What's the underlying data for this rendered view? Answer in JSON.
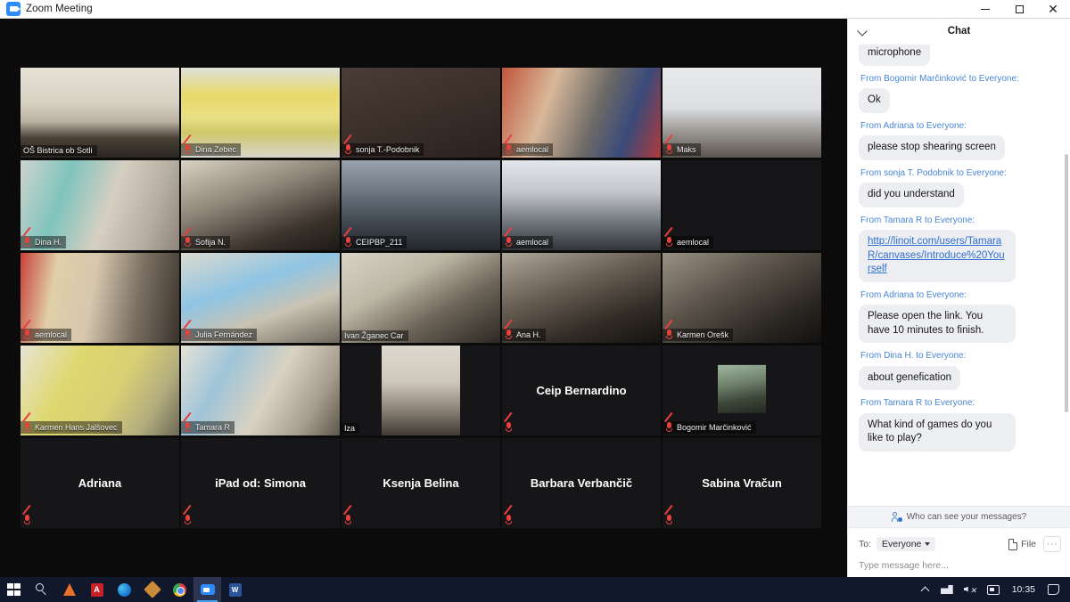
{
  "window": {
    "title": "Zoom Meeting",
    "app_icon": "zoom-camera-icon",
    "minimize_label": "",
    "maximize_label": "",
    "close_label": "✕"
  },
  "chat": {
    "title": "Chat",
    "collapse_icon": "chevron-down-icon",
    "messages": [
      {
        "from": "",
        "text": "microphone",
        "partial": true,
        "link": false
      },
      {
        "from": "From Bogomir Marčinković to Everyone:",
        "text": "Ok",
        "link": false
      },
      {
        "from": "From Adriana to Everyone:",
        "text": "please stop shearing screen",
        "link": false
      },
      {
        "from": "From sonja T. Podobnik to Everyone:",
        "text": "did you understand",
        "link": false
      },
      {
        "from": "From Tamara R to Everyone:",
        "text": "http://linoit.com/users/TamaraR/canvases/Introduce%20Yourself",
        "link": true
      },
      {
        "from": "From Adriana to Everyone:",
        "text": "Please open the link. You have 10 minutes to finish.",
        "link": false
      },
      {
        "from": "From Dina H. to Everyone:",
        "text": "about genefication",
        "link": false
      },
      {
        "from": "From Tamara R to Everyone:",
        "text": "What kind of games do you like to play?",
        "link": false
      }
    ],
    "notice": "Who can see your messages?",
    "notice_icon": "people-icon",
    "to_label": "To:",
    "to_value": "Everyone",
    "file_label": "File",
    "file_icon": "file-icon",
    "more_label": "···",
    "input_placeholder": "Type message here..."
  },
  "gallery": {
    "participants": [
      {
        "name": "OŠ Bistrica ob Sotli",
        "muted": false,
        "kind": "video",
        "bg": "classroom-a",
        "speaking": false
      },
      {
        "name": "Dina Zebec",
        "muted": true,
        "kind": "video",
        "bg": "masked-woman-yellow",
        "speaking": false
      },
      {
        "name": "sonja T.-Podobnik",
        "muted": true,
        "kind": "video",
        "bg": "dark-brown",
        "speaking": false
      },
      {
        "name": "aemlocal",
        "muted": true,
        "kind": "video",
        "bg": "classroom-red-flag",
        "speaking": false
      },
      {
        "name": "Maks",
        "muted": true,
        "kind": "video",
        "bg": "window-bright",
        "speaking": false
      },
      {
        "name": "Dina H.",
        "muted": true,
        "kind": "video",
        "bg": "girls-teal",
        "speaking": false
      },
      {
        "name": "Sofija N.",
        "muted": true,
        "kind": "video",
        "bg": "masked-girl-dark",
        "speaking": false
      },
      {
        "name": "CEIPBP_211",
        "muted": true,
        "kind": "video",
        "bg": "classroom-ceiling",
        "speaking": false
      },
      {
        "name": "aemlocal",
        "muted": true,
        "kind": "video",
        "bg": "ceiling-light",
        "speaking": false
      },
      {
        "name": "aemlocal",
        "muted": true,
        "kind": "blank",
        "bg": "black",
        "speaking": false
      },
      {
        "name": "aemlocal",
        "muted": true,
        "kind": "video",
        "bg": "flag-room",
        "speaking": false
      },
      {
        "name": "Julia Fernández",
        "muted": true,
        "kind": "video",
        "bg": "mask-light-blue",
        "speaking": false
      },
      {
        "name": "Ivan Žganec Car",
        "muted": false,
        "kind": "video",
        "bg": "classroom-boy",
        "speaking": false
      },
      {
        "name": "Ana H.",
        "muted": true,
        "kind": "video",
        "bg": "dark-mask-girl",
        "speaking": false
      },
      {
        "name": "Karmen Orešk",
        "muted": true,
        "kind": "video",
        "bg": "mask-dark-room",
        "speaking": false
      },
      {
        "name": "Karmen Hans Jalšovec",
        "muted": true,
        "kind": "video",
        "bg": "yellow-wall-woman",
        "speaking": false
      },
      {
        "name": "Tamara R",
        "muted": true,
        "kind": "video",
        "bg": "poster-wall-woman",
        "speaking": false
      },
      {
        "name": "Iza",
        "muted": false,
        "kind": "video",
        "bg": "sunglasses-outdoor",
        "speaking": true
      },
      {
        "name": "Ceip Bernardino",
        "muted": true,
        "kind": "name",
        "bg": "black",
        "speaking": false
      },
      {
        "name": "Bogomir Marčinković",
        "muted": true,
        "kind": "avatar",
        "bg": "black",
        "speaking": false
      },
      {
        "name": "Adriana",
        "muted": true,
        "kind": "name",
        "bg": "black",
        "speaking": false
      },
      {
        "name": "iPad od: Simona",
        "muted": true,
        "kind": "name",
        "bg": "black",
        "speaking": false
      },
      {
        "name": "Ksenja Belina",
        "muted": true,
        "kind": "name",
        "bg": "black",
        "speaking": false
      },
      {
        "name": "Barbara Verbančič",
        "muted": true,
        "kind": "name",
        "bg": "black",
        "speaking": false
      },
      {
        "name": "Sabina Vračun",
        "muted": true,
        "kind": "name",
        "bg": "black",
        "speaking": false
      }
    ]
  },
  "taskbar": {
    "items": [
      {
        "icon": "windows-start-icon",
        "active": false
      },
      {
        "icon": "search-icon",
        "active": false
      },
      {
        "icon": "vlc-icon",
        "active": false
      },
      {
        "icon": "adobe-acrobat-icon",
        "active": false
      },
      {
        "icon": "edge-icon",
        "active": false
      },
      {
        "icon": "package-icon",
        "active": false
      },
      {
        "icon": "chrome-icon",
        "active": false
      },
      {
        "icon": "zoom-icon",
        "active": true
      },
      {
        "icon": "word-icon",
        "active": false
      }
    ],
    "tray": {
      "overflow_icon": "chevron-up-icon",
      "network_icon": "network-icon",
      "volume_icon": "volume-muted-icon",
      "display_icon": "display-icon",
      "clock": "10:35",
      "notification_icon": "notification-icon"
    }
  },
  "colors": {
    "accent": "#2d8cff",
    "speaking_border": "#d4e82a",
    "mic_muted": "#e8413c",
    "chat_link": "#2f6fd0",
    "chat_from": "#4a86d6",
    "taskbar_bg": "#11182b"
  }
}
